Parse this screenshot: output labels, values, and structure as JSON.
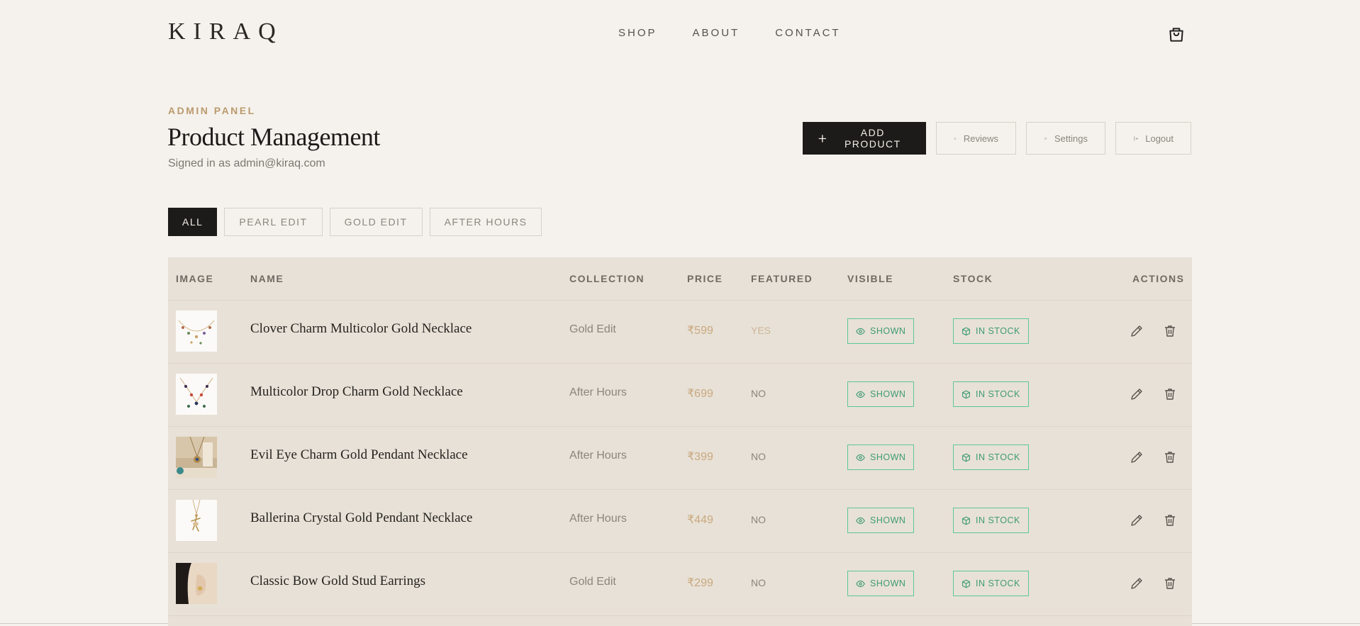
{
  "header": {
    "logo": "KIRAQ",
    "nav": [
      "SHOP",
      "ABOUT",
      "CONTACT"
    ],
    "cart_icon": "shopping-bag-icon"
  },
  "page": {
    "eyebrow": "ADMIN PANEL",
    "title": "Product Management",
    "signed_in": "Signed in as admin@kiraq.com"
  },
  "actions": {
    "add_product": "ADD PRODUCT",
    "reviews": "Reviews",
    "settings": "Settings",
    "logout": "Logout"
  },
  "filters": [
    "ALL",
    "PEARL EDIT",
    "GOLD EDIT",
    "AFTER HOURS"
  ],
  "table": {
    "headers": {
      "image": "IMAGE",
      "name": "NAME",
      "collection": "COLLECTION",
      "price": "PRICE",
      "featured": "FEATURED",
      "visible": "VISIBLE",
      "stock": "STOCK",
      "actions": "ACTIONS"
    },
    "rows": [
      {
        "name": "Clover Charm Multicolor Gold Necklace",
        "collection": "Gold Edit",
        "price": "₹599",
        "featured": "YES",
        "visible": "SHOWN",
        "stock": "IN STOCK"
      },
      {
        "name": "Multicolor Drop Charm Gold Necklace",
        "collection": "After Hours",
        "price": "₹699",
        "featured": "NO",
        "visible": "SHOWN",
        "stock": "IN STOCK"
      },
      {
        "name": "Evil Eye Charm Gold Pendant Necklace",
        "collection": "After Hours",
        "price": "₹399",
        "featured": "NO",
        "visible": "SHOWN",
        "stock": "IN STOCK"
      },
      {
        "name": "Ballerina Crystal Gold Pendant Necklace",
        "collection": "After Hours",
        "price": "₹449",
        "featured": "NO",
        "visible": "SHOWN",
        "stock": "IN STOCK"
      },
      {
        "name": "Classic Bow Gold Stud Earrings",
        "collection": "Gold Edit",
        "price": "₹299",
        "featured": "NO",
        "visible": "SHOWN",
        "stock": "IN STOCK"
      }
    ]
  },
  "colors": {
    "background": "#f5f2ed",
    "table_bg": "#e8e1d7",
    "accent_gold": "#bb9a6d",
    "status_green": "#3e9b74",
    "primary_dark": "#1c1b19"
  }
}
